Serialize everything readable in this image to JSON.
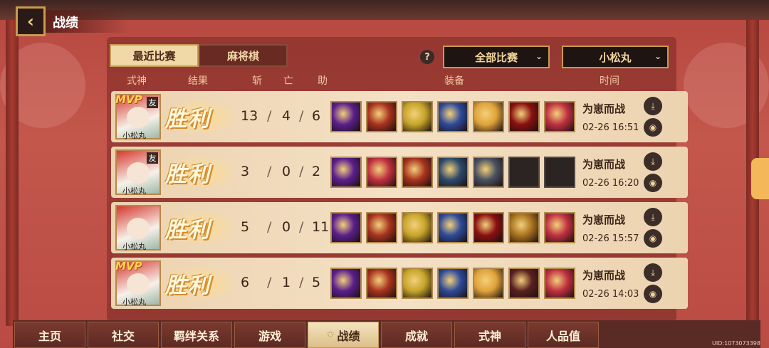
{
  "header": {
    "title": "战绩"
  },
  "tabs": [
    {
      "label": "最近比赛"
    },
    {
      "label": "麻将棋"
    }
  ],
  "filters": {
    "match_type": "全部比赛",
    "player": "小松丸"
  },
  "columns": [
    "式神",
    "结果",
    "斩",
    "亡",
    "助",
    "装备",
    "时间"
  ],
  "rows": [
    {
      "mvp": true,
      "mvp_label": "MVP",
      "friend_label": "友",
      "player": "小松丸",
      "result": "胜利",
      "kills": "13",
      "deaths": "4",
      "assists": "6",
      "mode": "为崽而战",
      "time": "02-26 16:51",
      "equip": [
        "#5a1f8c",
        "#a8321f",
        "#c7a52a",
        "#2e4a9a",
        "#e0a33a",
        "#8a1010",
        "#c03040"
      ]
    },
    {
      "mvp": false,
      "friend_label": "友",
      "player": "小松丸",
      "result": "胜利",
      "kills": "3",
      "deaths": "0",
      "assists": "2",
      "mode": "为崽而战",
      "time": "02-26 16:20",
      "equip": [
        "#5a1f8c",
        "#c03040",
        "#a8321f",
        "#2e4a6a",
        "#4a5060",
        "empty",
        "empty"
      ]
    },
    {
      "mvp": false,
      "player": "小松丸",
      "result": "胜利",
      "kills": "5",
      "deaths": "0",
      "assists": "11",
      "mode": "为崽而战",
      "time": "02-26 15:57",
      "equip": [
        "#5a1f8c",
        "#a8321f",
        "#c7a52a",
        "#2e4a9a",
        "#8a1010",
        "#a8721f",
        "#c03040"
      ]
    },
    {
      "mvp": true,
      "mvp_label": "MVP",
      "player": "小松丸",
      "result": "胜利",
      "kills": "6",
      "deaths": "1",
      "assists": "5",
      "mode": "为崽而战",
      "time": "02-26 14:03",
      "equip": [
        "#5a1f8c",
        "#a8321f",
        "#c7a52a",
        "#2e4a9a",
        "#e0a33a",
        "#5a2020",
        "#c03040"
      ]
    }
  ],
  "nav": [
    "主页",
    "社交",
    "羁绊关系",
    "游戏",
    "战绩",
    "成就",
    "式神",
    "人品值"
  ],
  "nav_active": "战绩",
  "uid": "UID:1073073398"
}
